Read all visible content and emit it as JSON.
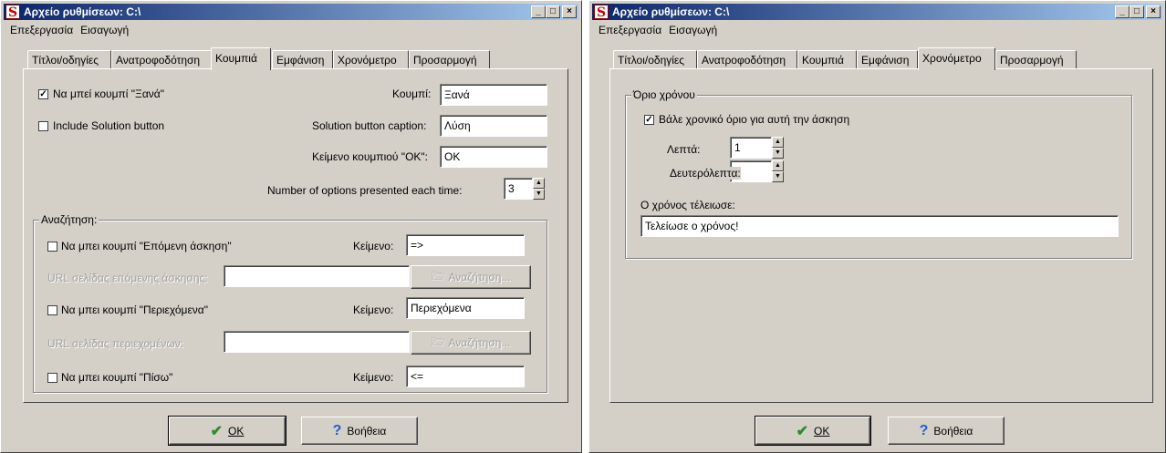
{
  "left": {
    "title": "Αρχείο ρυθμίσεων: C:\\",
    "menu": [
      "Επεξεργασία",
      "Εισαγωγή"
    ],
    "tabs": [
      "Τίτλοι/οδηγίες",
      "Ανατροφοδότηση",
      "Κουμπιά",
      "Εμφάνιση",
      "Χρονόμετρο",
      "Προσαρμογή"
    ],
    "active_tab": "Κουμπιά",
    "again_checkbox": {
      "label": "Να μπεί κουμπί \"Ξανά\"",
      "checked": true
    },
    "solution_checkbox": {
      "label": "Include Solution button",
      "checked": false
    },
    "button_caption_label": "Κουμπί:",
    "button_caption_value": "Ξανά",
    "solution_caption_label": "Solution button caption:",
    "solution_caption_value": "Λύση",
    "ok_caption_label": "Κείμενο κουμπιού \"OK\":",
    "ok_caption_value": "OK",
    "options_label": "Number of options presented each time:",
    "options_value": "3",
    "navigation": {
      "title": "Αναζήτηση:",
      "next": {
        "label": "Να μπει κουμπί \"Επόμενη άσκηση\"",
        "text_label": "Κείμενο:",
        "text_value": "=>"
      },
      "next_url_label": "URL σελίδας επόμενης άσκησης:",
      "contents": {
        "label": "Να μπει κουμπί \"Περιεχόμενα\"",
        "text_label": "Κείμενο:",
        "text_value": "Περιεχόμενα"
      },
      "contents_url_label": "URL σελίδας περιεχομένων:",
      "back": {
        "label": "Να μπει κουμπί \"Πίσω\"",
        "text_label": "Κείμενο:",
        "text_value": "<="
      },
      "browse_label": "Αναζήτηση..."
    },
    "ok_button": "OK",
    "help_button": "Βοήθεια"
  },
  "right": {
    "title": "Αρχείο ρυθμίσεων: C:\\",
    "menu": [
      "Επεξεργασία",
      "Εισαγωγή"
    ],
    "tabs": [
      "Τίτλοι/οδηγίες",
      "Ανατροφοδότηση",
      "Κουμπιά",
      "Εμφάνιση",
      "Χρονόμετρο",
      "Προσαρμογή"
    ],
    "active_tab": "Χρονόμετρο",
    "time_limit": {
      "title": "Όριο χρόνου",
      "checkbox_label": "Βάλε χρονικό όριο για αυτή την άσκηση",
      "checked": true,
      "minutes_label": "Λεπτά:",
      "minutes_value": "1",
      "seconds_label": "Δευτερόλεπτα:",
      "seconds_value": ""
    },
    "time_up_label": "Ο χρόνος τέλειωσε:",
    "time_up_value": "Τελείωσε ο χρόνος!",
    "ok_button": "OK",
    "help_button": "Βοήθεια"
  },
  "icons": {
    "app": "app-s-icon",
    "minimize": "minimize-icon",
    "maximize": "maximize-icon",
    "close": "close-icon",
    "ok": "checkmark-icon",
    "help": "question-mark-icon",
    "browse": "folder-open-icon",
    "spin_up": "spin-up-icon",
    "spin_down": "spin-down-icon"
  },
  "colors": {
    "titlebar_start": "#0a246a",
    "titlebar_end": "#a6caf0",
    "face": "#d4d0c8",
    "ok_icon": "#2e8b2e",
    "help_icon": "#1e5fd0",
    "app_icon": "#cc0000"
  }
}
